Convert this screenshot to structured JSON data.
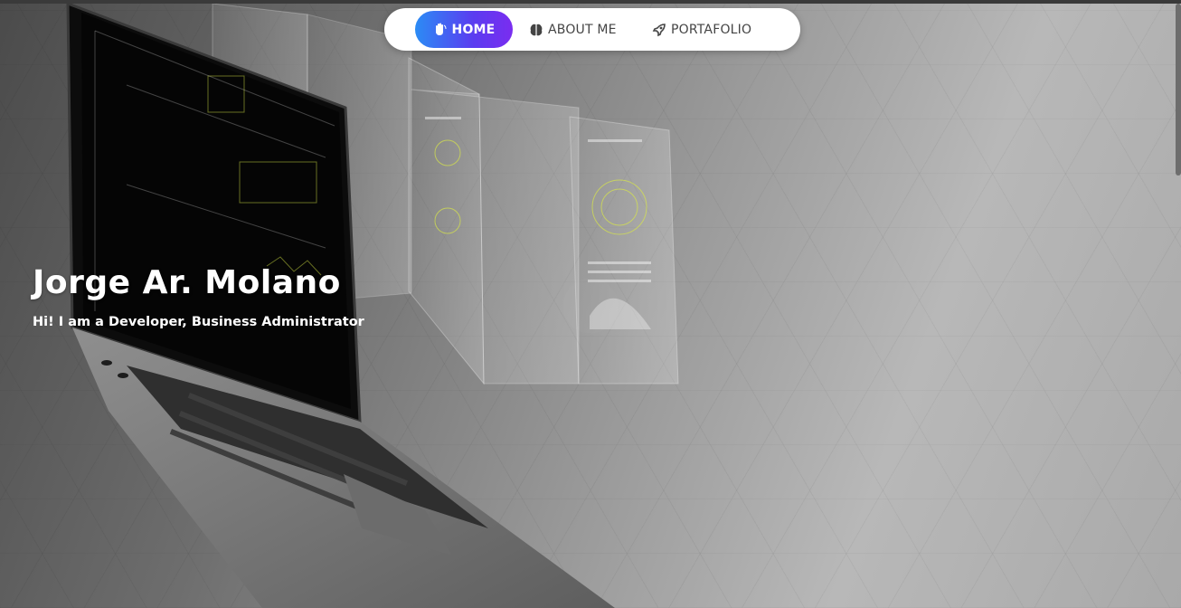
{
  "nav": {
    "home_label": "HOME",
    "about_label": "ABOUT ME",
    "portfolio_label": "PORTAFOLIO",
    "active_gradient": [
      "#2b8cf5",
      "#7a2df0"
    ],
    "icons": {
      "home": "waving-hand-icon",
      "about": "brain-icon",
      "portfolio": "rocket-icon"
    }
  },
  "hero": {
    "name": "Jorge Ar. Molano",
    "tagline": "Hi! I am a Developer, Business Administrator"
  }
}
